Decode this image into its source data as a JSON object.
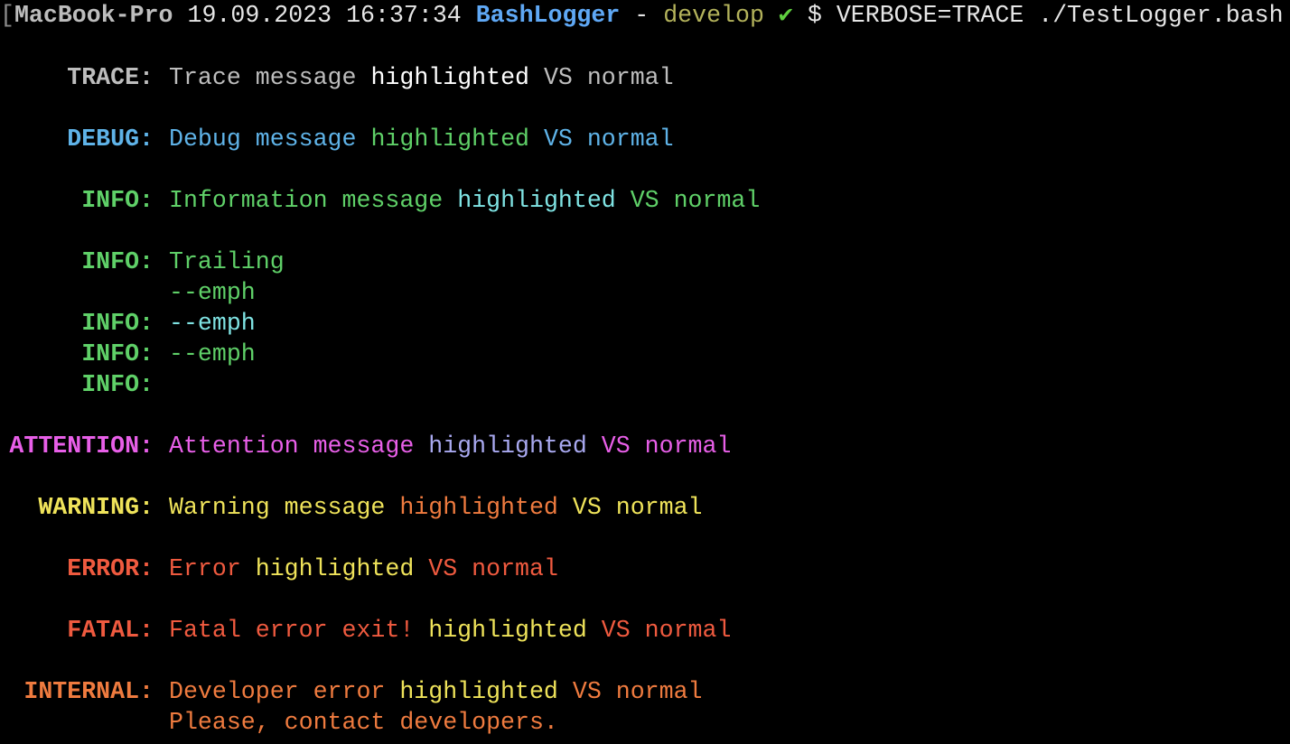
{
  "prompt": {
    "bracket": "[",
    "host": "MacBook-Pro",
    "date": "19.09.2023",
    "time": "16:37:34",
    "project": "BashLogger",
    "dash": "-",
    "branch": "develop",
    "check": "✔",
    "dollar": "$",
    "command": "VERBOSE=TRACE ./TestLogger.bash"
  },
  "colors": {
    "trace": "#bdbdbd",
    "trace_hl": "#ffffff",
    "debug": "#5fb3e8",
    "debug_hl": "#5fd068",
    "info": "#5fd068",
    "info_hl": "#7fe3e3",
    "attention": "#e85fe8",
    "attention_hl": "#a9a9f0",
    "warning": "#efe35a",
    "warning_hl": "#ef7b3f",
    "error": "#ef5a3f",
    "error_hl": "#efe35a",
    "internal": "#ef7b3f",
    "internal_hl": "#efe35a"
  },
  "lines": [
    {
      "level": "TRACE:",
      "parts": [
        [
          "Trace message ",
          "trace"
        ],
        [
          "highlighted",
          "trace_hl"
        ],
        [
          " VS normal",
          "trace"
        ]
      ]
    },
    {
      "level": "DEBUG:",
      "parts": [
        [
          "Debug message ",
          "debug"
        ],
        [
          "highlighted",
          "debug_hl"
        ],
        [
          " VS normal",
          "debug"
        ]
      ]
    },
    {
      "level": "INFO:",
      "parts": [
        [
          "Information message ",
          "info"
        ],
        [
          "highlighted",
          "info_hl"
        ],
        [
          " VS normal",
          "info"
        ]
      ]
    },
    {
      "level": "INFO:",
      "parts": [
        [
          "Trailing",
          "info"
        ]
      ]
    },
    {
      "level": "",
      "parts": [
        [
          "--emph",
          "info"
        ]
      ]
    },
    {
      "level": "INFO:",
      "parts": [
        [
          "--emph",
          "info_hl"
        ]
      ]
    },
    {
      "level": "INFO:",
      "parts": [
        [
          "--emph",
          "info"
        ]
      ]
    },
    {
      "level": "INFO:",
      "parts": []
    },
    {
      "level": "ATTENTION:",
      "parts": [
        [
          "Attention message ",
          "attention"
        ],
        [
          "highlighted",
          "attention_hl"
        ],
        [
          " VS normal",
          "attention"
        ]
      ]
    },
    {
      "level": "WARNING:",
      "parts": [
        [
          "Warning message ",
          "warning"
        ],
        [
          "highlighted",
          "warning_hl"
        ],
        [
          " VS normal",
          "warning"
        ]
      ]
    },
    {
      "level": "ERROR:",
      "parts": [
        [
          "Error ",
          "error"
        ],
        [
          "highlighted",
          "error_hl"
        ],
        [
          " VS normal",
          "error"
        ]
      ]
    },
    {
      "level": "FATAL:",
      "parts": [
        [
          "Fatal error exit! ",
          "error"
        ],
        [
          "highlighted",
          "error_hl"
        ],
        [
          " VS normal",
          "error"
        ]
      ]
    },
    {
      "level": "INTERNAL:",
      "parts": [
        [
          "Developer error ",
          "internal"
        ],
        [
          "highlighted",
          "internal_hl"
        ],
        [
          " VS normal",
          "internal"
        ]
      ]
    },
    {
      "level": "",
      "parts": [
        [
          "Please, contact developers.",
          "internal"
        ]
      ]
    }
  ]
}
